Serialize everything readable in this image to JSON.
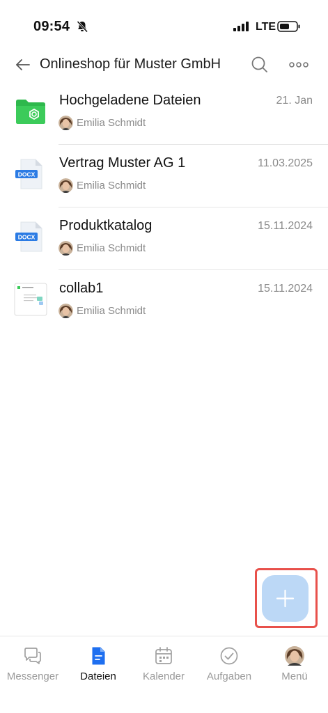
{
  "status_bar": {
    "time": "09:54",
    "network": "LTE"
  },
  "header": {
    "title": "Onlineshop für Muster GmbH",
    "back_icon": "arrow-left-icon",
    "search_icon": "search-icon",
    "more_icon": "more-horizontal-icon"
  },
  "files": [
    {
      "name": "Hochgeladene Dateien",
      "date": "21. Jan",
      "owner": "Emilia Schmidt",
      "type": "folder"
    },
    {
      "name": "Vertrag Muster AG 1",
      "date": "11.03.2025",
      "owner": "Emilia Schmidt",
      "type": "docx",
      "badge": "DOCX"
    },
    {
      "name": "Produktkatalog",
      "date": "15.11.2024",
      "owner": "Emilia Schmidt",
      "type": "docx",
      "badge": "DOCX"
    },
    {
      "name": "collab1",
      "date": "15.11.2024",
      "owner": "Emilia Schmidt",
      "type": "board"
    }
  ],
  "fab": {
    "icon": "plus-icon"
  },
  "bottom_nav": {
    "items": [
      {
        "label": "Messenger",
        "icon": "chat-bubbles-icon",
        "active": false
      },
      {
        "label": "Dateien",
        "icon": "document-icon",
        "active": true
      },
      {
        "label": "Kalender",
        "icon": "calendar-icon",
        "active": false
      },
      {
        "label": "Aufgaben",
        "icon": "check-circle-icon",
        "active": false
      },
      {
        "label": "Menü",
        "icon": "avatar",
        "active": false
      }
    ]
  },
  "colors": {
    "accent": "#1e6ff0",
    "folder_green": "#2eb84c",
    "fab_bg": "#bcd8f6",
    "highlight": "#e8514b",
    "muted_text": "#8a8a8a"
  }
}
